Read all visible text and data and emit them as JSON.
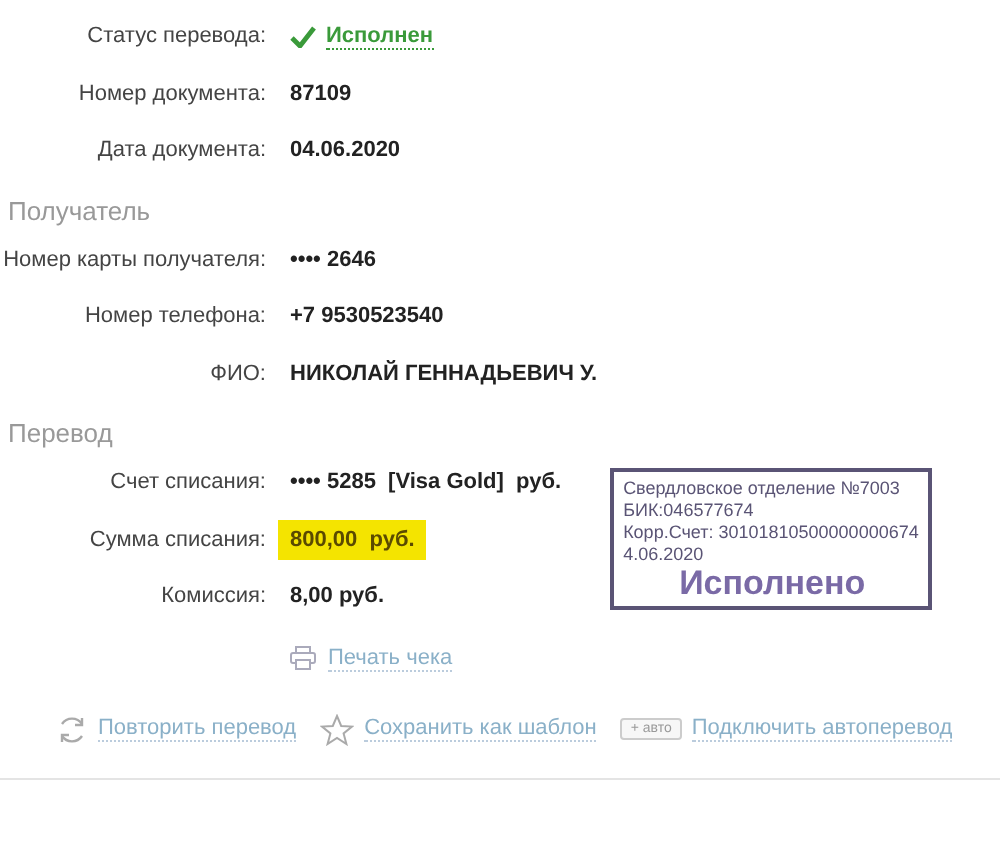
{
  "sections": [
    {
      "rows": [
        {
          "kind": "status",
          "label": "Статус перевода:",
          "value": "Исполнен"
        },
        {
          "kind": "text",
          "label": "Номер документа:",
          "value": "87109"
        },
        {
          "kind": "text",
          "label": "Дата документа:",
          "value": "04.06.2020"
        }
      ]
    },
    {
      "title": "Получатель",
      "rows": [
        {
          "kind": "text",
          "label": "Номер карты получателя:",
          "value": "•••• 2646"
        },
        {
          "kind": "text",
          "label": "Номер телефона:",
          "value": "+7 9530523540"
        },
        {
          "kind": "text",
          "label": "ФИО:",
          "value": "НИКОЛАЙ ГЕННАДЬЕВИЧ У."
        }
      ]
    },
    {
      "title": "Перевод",
      "rows": [
        {
          "kind": "text",
          "label": "Счет списания:",
          "value": "•••• 5285  [Visa Gold]  руб."
        },
        {
          "kind": "highlight",
          "label": "Сумма списания:",
          "value": "800,00  руб."
        },
        {
          "kind": "text",
          "label": "Комиссия:",
          "value": "8,00 руб."
        }
      ],
      "stamp": {
        "lines": [
          "Свердловское отделение №7003",
          "БИК:046577674",
          "Корр.Счет: 30101810500000000674"
        ],
        "mark": "Исполнено",
        "date": "4.06.2020"
      }
    }
  ],
  "print_link": "Печать чека",
  "actions": [
    {
      "kind": "repeat",
      "label": "Повторить перевод"
    },
    {
      "kind": "star",
      "label": "Сохранить как шаблон"
    },
    {
      "kind": "auto",
      "badge": "+ авто",
      "label": "Подключить автоперевод"
    }
  ]
}
